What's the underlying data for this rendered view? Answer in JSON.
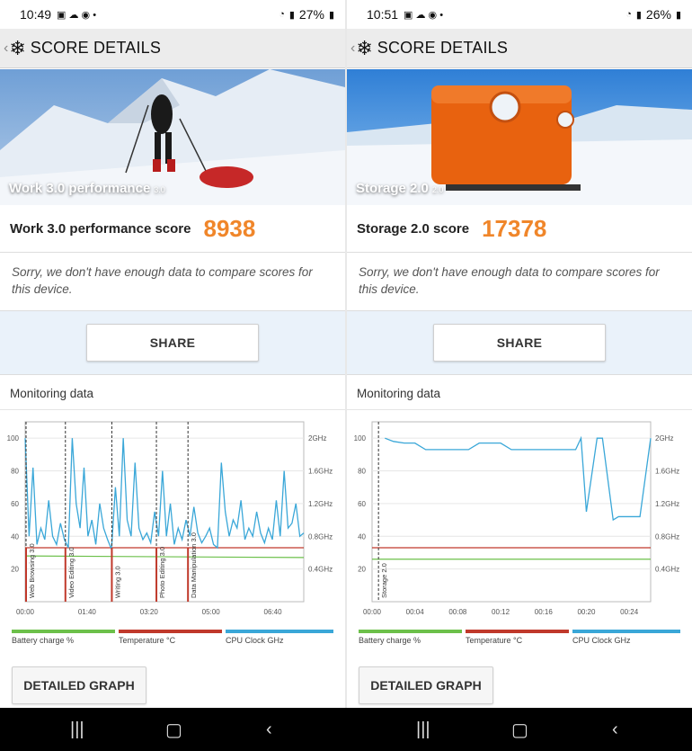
{
  "screens": [
    {
      "status": {
        "time": "10:49",
        "battery": "27%"
      },
      "app_title": "SCORE DETAILS",
      "hero": {
        "label": "Work 3.0 performance",
        "version": "3.0"
      },
      "score": {
        "label": "Work 3.0 performance score",
        "value": "8938"
      },
      "sorry_text": "Sorry, we don't have enough data to compare scores for this device.",
      "share_label": "SHARE",
      "monitoring_title": "Monitoring data",
      "detailed_label": "DETAILED GRAPH",
      "legend": [
        "Battery charge %",
        "Temperature °C",
        "CPU Clock GHz"
      ]
    },
    {
      "status": {
        "time": "10:51",
        "battery": "26%"
      },
      "app_title": "SCORE DETAILS",
      "hero": {
        "label": "Storage 2.0",
        "version": "2.0"
      },
      "score": {
        "label": "Storage 2.0 score",
        "value": "17378"
      },
      "sorry_text": "Sorry, we don't have enough data to compare scores for this device.",
      "share_label": "SHARE",
      "monitoring_title": "Monitoring data",
      "detailed_label": "DETAILED GRAPH",
      "legend": [
        "Battery charge %",
        "Temperature °C",
        "CPU Clock GHz"
      ]
    }
  ],
  "colors": {
    "battery": "#6cc04a",
    "temperature": "#c0392b",
    "cpu": "#3aa7d8",
    "score": "#f0862a"
  },
  "chart_data": [
    {
      "type": "line",
      "ylim": [
        0,
        110
      ],
      "y_ticks_left": [
        "100",
        "80",
        "60",
        "40",
        "20"
      ],
      "y_ticks_right": [
        "2GHz",
        "1.6GHz",
        "1.2GHz",
        "0.8GHz",
        "0.4GHz"
      ],
      "x_ticks": [
        "00:00",
        "01:40",
        "03:20",
        "05:00",
        "06:40"
      ],
      "xlim_minutes": [
        0,
        450
      ],
      "markers": [
        {
          "label": "Web Browsing 3.0",
          "at": 0
        },
        {
          "label": "Video Editing 3.0",
          "at": 65
        },
        {
          "label": "Writing 3.0",
          "at": 140
        },
        {
          "label": "Photo Editing 3.0",
          "at": 212
        },
        {
          "label": "Data Manipulation 3.0",
          "at": 263
        }
      ],
      "series": [
        {
          "name": "Battery charge %",
          "values": [
            28,
            27
          ]
        },
        {
          "name": "Temperature °C",
          "values": [
            33,
            33
          ]
        },
        {
          "name": "CPU Clock GHz",
          "values": [
            100,
            40,
            82,
            35,
            45,
            38,
            62,
            40,
            35,
            48,
            38,
            33,
            100,
            60,
            45,
            82,
            40,
            50,
            35,
            60,
            45,
            38,
            32,
            70,
            40,
            100,
            50,
            40,
            85,
            45,
            38,
            42,
            36,
            55,
            40,
            80,
            40,
            60,
            35,
            45,
            38,
            50,
            40,
            58,
            42,
            36,
            40,
            45,
            35,
            33,
            85,
            55,
            40,
            50,
            45,
            62,
            38,
            45,
            40,
            55,
            42,
            36,
            45,
            38,
            62,
            40,
            80,
            45,
            48,
            60,
            40,
            42
          ]
        }
      ]
    },
    {
      "type": "line",
      "ylim": [
        0,
        110
      ],
      "y_ticks_left": [
        "100",
        "80",
        "60",
        "40",
        "20"
      ],
      "y_ticks_right": [
        "2GHz",
        "1.6GHz",
        "1.2GHz",
        "0.8GHz",
        "0.4GHz"
      ],
      "x_ticks": [
        "00:00",
        "00:04",
        "00:08",
        "00:12",
        "00:16",
        "00:20",
        "00:24"
      ],
      "xlim_minutes": [
        0,
        26
      ],
      "markers": [
        {
          "label": "Storage 2.0",
          "at": 0.6
        }
      ],
      "series": [
        {
          "name": "Battery charge %",
          "values": [
            26,
            26
          ]
        },
        {
          "name": "Temperature °C",
          "values": [
            33,
            33
          ]
        },
        {
          "name": "CPU Clock GHz",
          "x": [
            1.2,
            2,
            3,
            4,
            5,
            8,
            9,
            10,
            11,
            12,
            13,
            14,
            15,
            16,
            18,
            19,
            19.5,
            20,
            21,
            21.5,
            22.5,
            23,
            23.5,
            24,
            25,
            26
          ],
          "values": [
            100,
            98,
            97,
            97,
            93,
            93,
            93,
            97,
            97,
            97,
            93,
            93,
            93,
            93,
            93,
            93,
            100,
            55,
            100,
            100,
            50,
            52,
            52,
            52,
            52,
            100
          ]
        }
      ]
    }
  ]
}
